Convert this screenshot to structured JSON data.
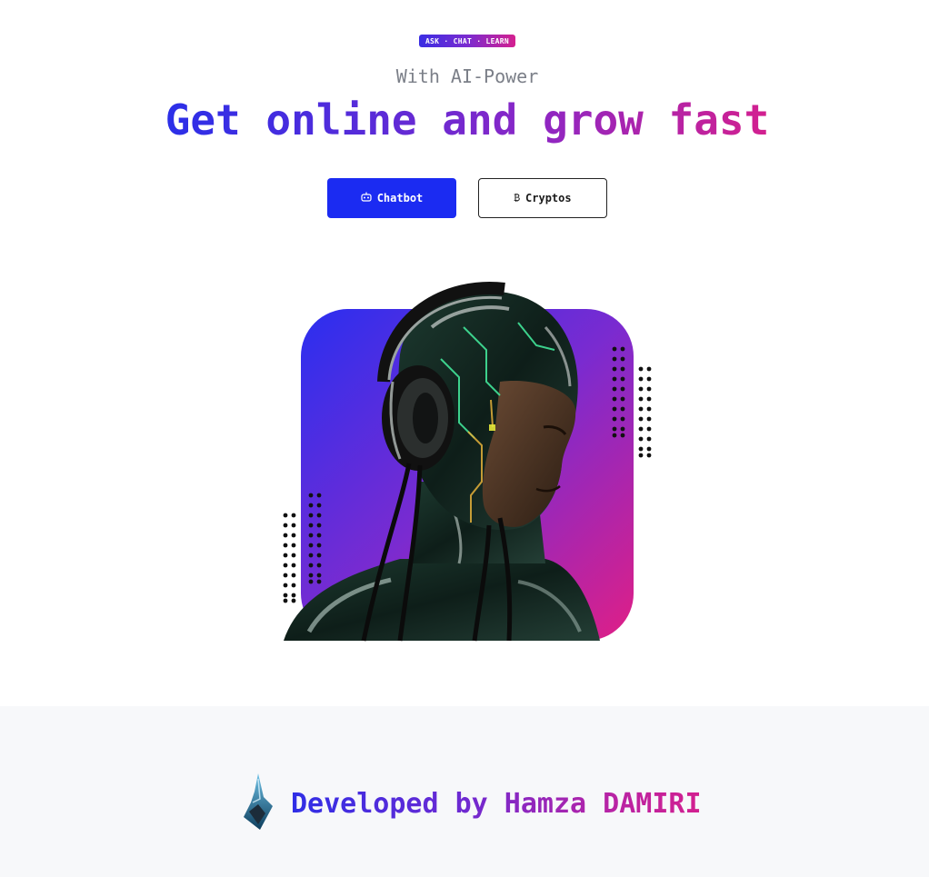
{
  "hero": {
    "badge": "ASK · CHAT · LEARN",
    "subtitle": "With AI-Power",
    "headline": "Get online and grow fast",
    "buttons": {
      "chatbot_icon": "robot-icon",
      "chatbot_label": "Chatbot",
      "cryptos_icon": "bitcoin-icon",
      "cryptos_label": "Cryptos"
    }
  },
  "illustration": {
    "subject": "ai-humanoid-with-headphones",
    "gradient": [
      "#2a2ff0",
      "#7a2bd0",
      "#e01f86"
    ]
  },
  "footer": {
    "logo": "brand-logo-icon",
    "credit": "Developed by Hamza DAMIRI"
  },
  "colors": {
    "primary": "#1b2bf2",
    "accent_purple": "#7a2bd0",
    "accent_pink": "#d3208f",
    "footer_bg": "#f7f8fa"
  }
}
